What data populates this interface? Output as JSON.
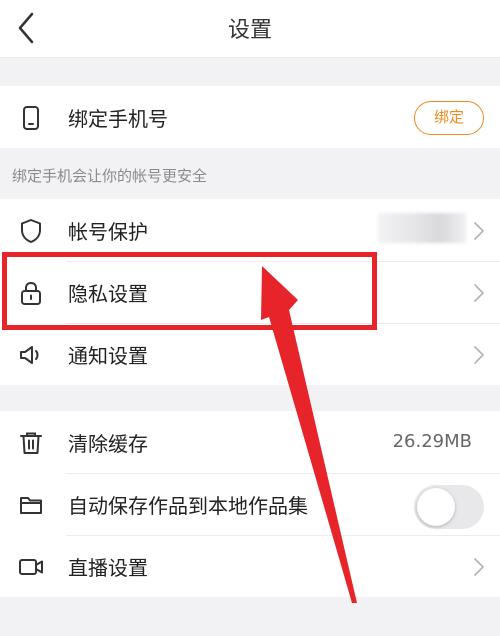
{
  "header": {
    "title": "设置"
  },
  "phone_section": {
    "label": "绑定手机号",
    "bind_button": "绑定",
    "hint": "绑定手机会让你的帐号更安全"
  },
  "settings": {
    "account_protection": "帐号保护",
    "privacy_settings": "隐私设置",
    "notification_settings": "通知设置"
  },
  "storage": {
    "clear_cache": "清除缓存",
    "cache_size": "26.29MB",
    "auto_save": "自动保存作品到本地作品集",
    "auto_save_enabled": false,
    "live_settings": "直播设置"
  },
  "colors": {
    "accent": "#f08a1e",
    "annotation": "#e8242b"
  }
}
